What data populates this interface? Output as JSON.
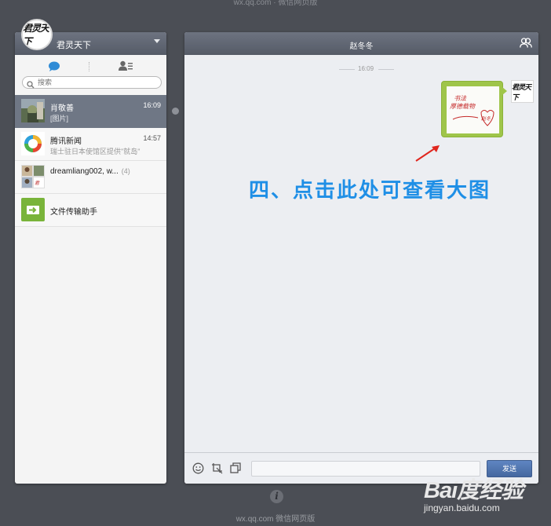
{
  "window": {
    "top_caption": "wx.qq.com · 微信网页版",
    "bottom_caption": "wx.qq.com 微信网页版"
  },
  "sidebar": {
    "username": "君灵天下",
    "avatar_text": "君灵天下",
    "search_placeholder": "搜索",
    "conversations": [
      {
        "name": "肖敬善",
        "preview": "[图片]",
        "time": "16:09",
        "active": true
      },
      {
        "name": "腾讯新闻",
        "preview": "瑞士驻日本使馆区提供\"就岛\"",
        "time": "14:57",
        "active": false
      },
      {
        "name": "dreamliang002, w...",
        "preview": "",
        "time": "",
        "count": "(4)",
        "active": false
      },
      {
        "name": "文件传输助手",
        "preview": "",
        "time": "",
        "active": false
      }
    ]
  },
  "chat": {
    "title": "赵冬冬",
    "time_divider": "16:09",
    "image_text_line1": "书法",
    "image_text_line2": "厚德载物",
    "image_text_line3": "赵冬",
    "my_avatar_text": "君灵天下",
    "annotation": "四、点击此处可查看大图",
    "input_value": "",
    "send_label": "发送"
  },
  "footer": {
    "info_glyph": "i"
  },
  "watermark": {
    "brand": "Bai度经验",
    "url": "jingyan.baidu.com"
  },
  "colors": {
    "background": "#4b4e55",
    "header": "#5d6370",
    "active_item": "#6f7785",
    "bubble": "#9fc54a",
    "annotation": "#1f8fe6",
    "send_button": "#5276b0"
  }
}
